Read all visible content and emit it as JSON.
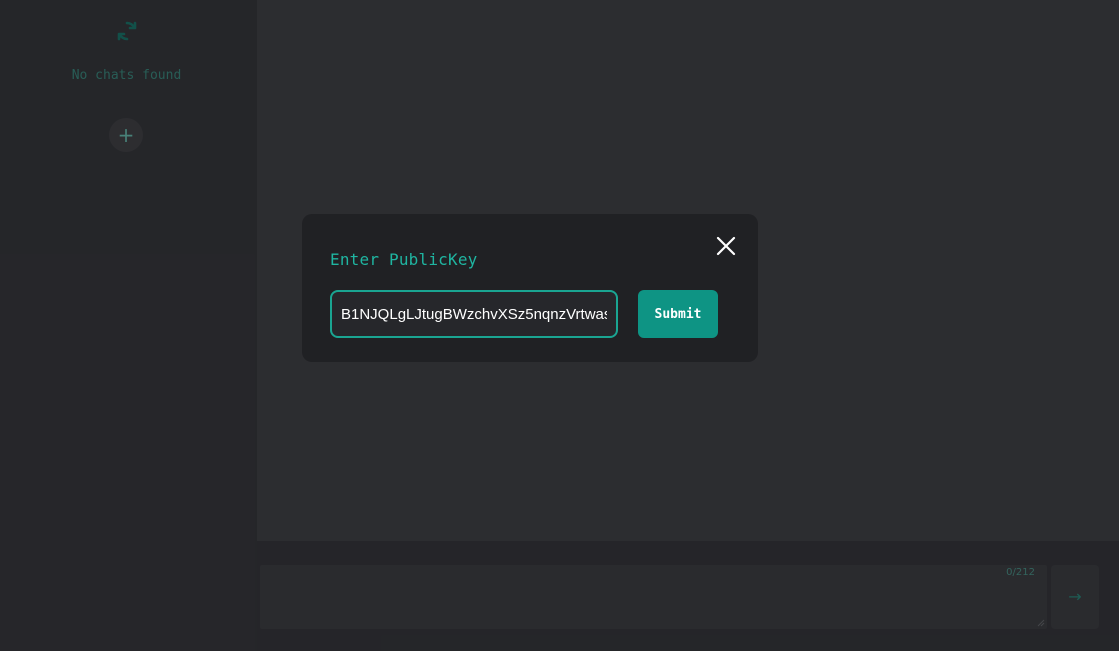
{
  "sidebar": {
    "refresh_icon": "refresh-icon",
    "empty_text": "No chats found",
    "add_label": "+",
    "collapse_label": "<"
  },
  "composer": {
    "char_count": "0/212",
    "send_label": "→"
  },
  "modal": {
    "title": "Enter PublicKey",
    "input_value": "B1NJQLgLJtugBWzchvXSz5nqnzVrtwas",
    "submit_label": "Submit",
    "close_icon": "close-icon"
  },
  "colors": {
    "accent": "#1fb5a1",
    "button": "#0e9484",
    "modal_bg": "#202124"
  }
}
